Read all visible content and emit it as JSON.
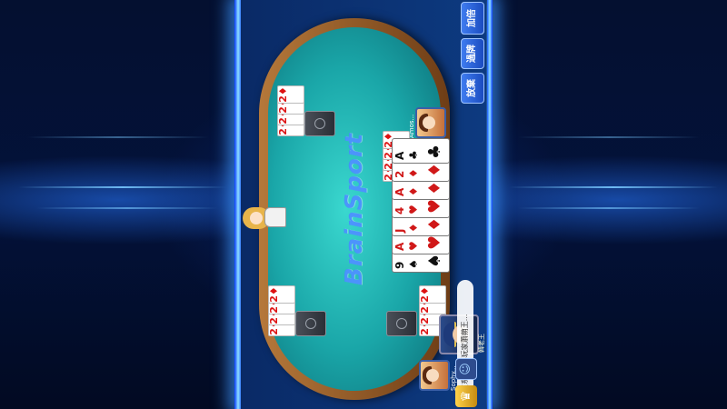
{
  "brand": {
    "logo_text": "BrainSport"
  },
  "players": [
    {
      "name": "Amos...",
      "hand": [
        "2♦",
        "2♦",
        "2♦",
        "2♦"
      ]
    },
    {
      "name": "",
      "hand": [
        "2♦",
        "2♦",
        "2♦",
        "2♦"
      ]
    },
    {
      "name": "",
      "hand": [
        "2♦",
        "2♦",
        "2♦",
        "2♦"
      ]
    },
    {
      "name": "Sophy...",
      "hand": [
        "2♦",
        "2♦",
        "2♦",
        "2♦"
      ]
    }
  ],
  "my_hand": [
    {
      "rank": "9",
      "suit": "♠",
      "color": "black"
    },
    {
      "rank": "A",
      "suit": "♥",
      "color": "red"
    },
    {
      "rank": "J",
      "suit": "♦",
      "color": "red"
    },
    {
      "rank": "4",
      "suit": "♥",
      "color": "red"
    },
    {
      "rank": "A",
      "suit": "♦",
      "color": "red"
    },
    {
      "rank": "2",
      "suit": "♦",
      "color": "red"
    },
    {
      "rank": "A",
      "suit": "♣",
      "color": "black"
    }
  ],
  "me": {
    "name": "韓老王"
  },
  "actions": {
    "giveup": "放棄",
    "pass": "過牌",
    "base": "基底",
    "raise": "加倍"
  },
  "chat": {
    "message": "[系] 恭喜玩家蕭蒴王..."
  },
  "icons": {
    "chat": "chat-bubble-icon",
    "crown": "crown-icon",
    "smile": "emoji-icon"
  }
}
